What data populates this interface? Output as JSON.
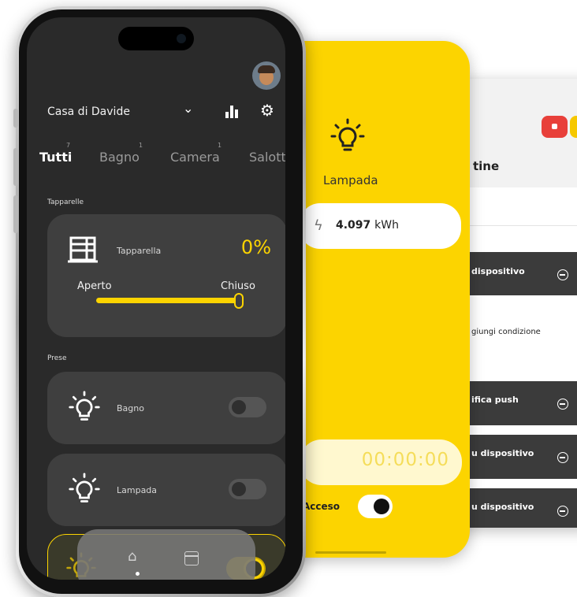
{
  "routine_panel": {
    "title_partial": "tine",
    "rows": [
      {
        "label": "dispositivo",
        "style": "dark"
      },
      {
        "label": "giungi condizione",
        "style": "light"
      },
      {
        "label": "ifica push",
        "style": "dark"
      },
      {
        "label": "u dispositivo",
        "style": "dark"
      },
      {
        "label": "u dispositivo",
        "style": "dark"
      }
    ]
  },
  "lamp_panel": {
    "title": "Lampada",
    "energy_value": "4.097",
    "energy_unit": "kWh",
    "timer": "00:00:00",
    "power_label": "Acceso",
    "power_on": true
  },
  "app": {
    "home_title": "Casa di Davide",
    "tabs": [
      {
        "label": "Tutti",
        "count": "7",
        "active": true
      },
      {
        "label": "Bagno",
        "count": "1",
        "active": false
      },
      {
        "label": "Camera",
        "count": "1",
        "active": false
      },
      {
        "label": "Salotto",
        "count": "",
        "active": false
      }
    ],
    "sections": {
      "shutters": "Tapparelle",
      "sockets": "Prese"
    },
    "shutter_card": {
      "name": "Tapparella",
      "percent": "0%",
      "label_open": "Aperto",
      "label_closed": "Chiuso",
      "level": 1.0
    },
    "devices": [
      {
        "name": "Bagno",
        "on": false
      },
      {
        "name": "Lampada",
        "on": false
      }
    ]
  },
  "colors": {
    "accent": "#fcd400",
    "screen_bg": "#2a2a2a",
    "card_bg": "#3f3f3f"
  },
  "icons": [
    "lightbulb-icon",
    "lightning-icon",
    "shutter-icon",
    "chevron-down-icon",
    "stats-icon",
    "gear-icon",
    "home-icon",
    "calendar-icon",
    "minus-circle-icon"
  ]
}
